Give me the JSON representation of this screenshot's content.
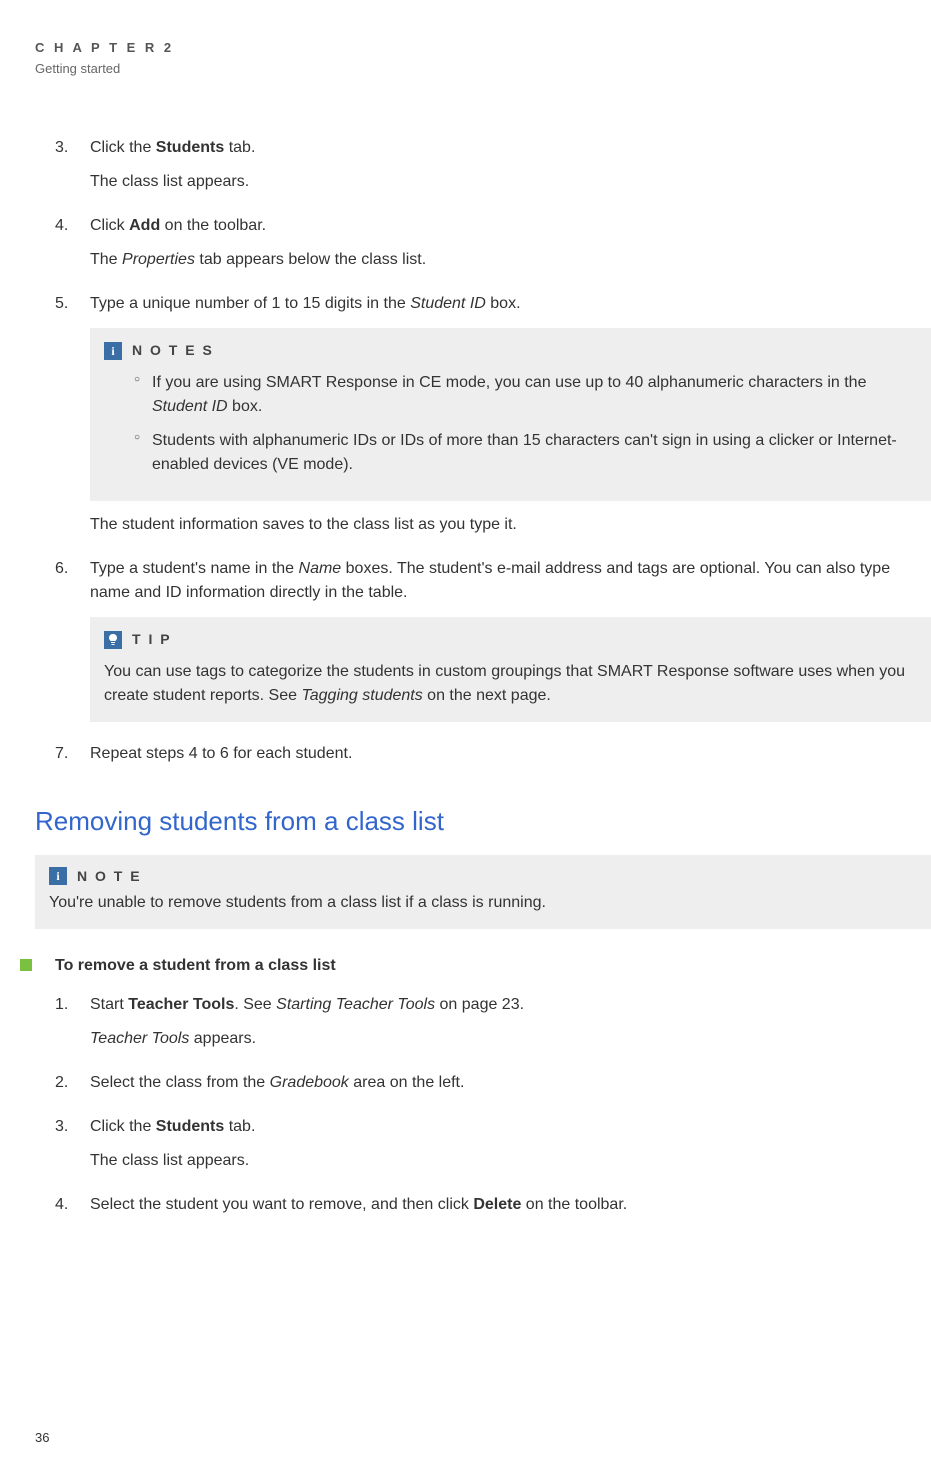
{
  "header": {
    "chapter_label": "C H A P T E R  2",
    "chapter_sub": "Getting started"
  },
  "steps_first": [
    {
      "line1_pre": "Click the ",
      "line1_bold": "Students",
      "line1_post": " tab.",
      "sub": "The class list appears."
    },
    {
      "line1_pre": "Click ",
      "line1_bold": "Add",
      "line1_post": " on the toolbar.",
      "sub_pre": "The ",
      "sub_i": "Properties",
      "sub_post": " tab appears below the class list."
    },
    {
      "line1_pre": "Type a unique number of 1 to 15 digits in the ",
      "line1_i": "Student ID",
      "line1_post": " box.",
      "notes_title": "N O T E S",
      "notes_items": [
        {
          "pre": "If you are using SMART Response in CE mode, you can use up to 40 alphanumeric characters in the ",
          "i": "Student ID",
          "post": " box."
        },
        {
          "pre": "Students with alphanumeric IDs or IDs of more than 15 characters can't sign in using a clicker or Internet-enabled devices (VE mode).",
          "i": "",
          "post": ""
        }
      ],
      "after_notes": "The student information saves to the class list as you type it."
    },
    {
      "line1_pre": "Type a student's name in the ",
      "line1_i": "Name",
      "line1_post": " boxes. The student's e-mail address and tags are optional. You can also type name and ID information directly in the table.",
      "tip_title": "T I P",
      "tip_body_pre": "You can use tags to categorize the students in custom groupings that SMART Response software uses when you create student reports. See ",
      "tip_body_i": "Tagging students",
      "tip_body_post": " on the next page."
    },
    {
      "line1_pre": "Repeat steps 4 to 6 for each student.",
      "line1_bold": "",
      "line1_post": ""
    }
  ],
  "section2": {
    "heading": "Removing students from a class list",
    "note_title": "N O T E",
    "note_body": "You're unable to remove students from a class list if a class is running.",
    "procedure_heading": "To remove a student from a class list",
    "steps": [
      {
        "pre": "Start ",
        "b": "Teacher Tools",
        "post": ". See ",
        "i": "Starting Teacher Tools",
        "post2": " on page 23.",
        "sub_i": "Teacher Tools",
        "sub_post": " appears."
      },
      {
        "pre": "Select the class from the ",
        "i": "Gradebook",
        "post2": " area on the left."
      },
      {
        "pre": "Click the ",
        "b": "Students",
        "post": " tab.",
        "sub": "The class list appears."
      },
      {
        "pre": "Select the student you want to remove, and then click ",
        "b": "Delete",
        "post": " on the toolbar."
      }
    ]
  },
  "page_number": "36"
}
